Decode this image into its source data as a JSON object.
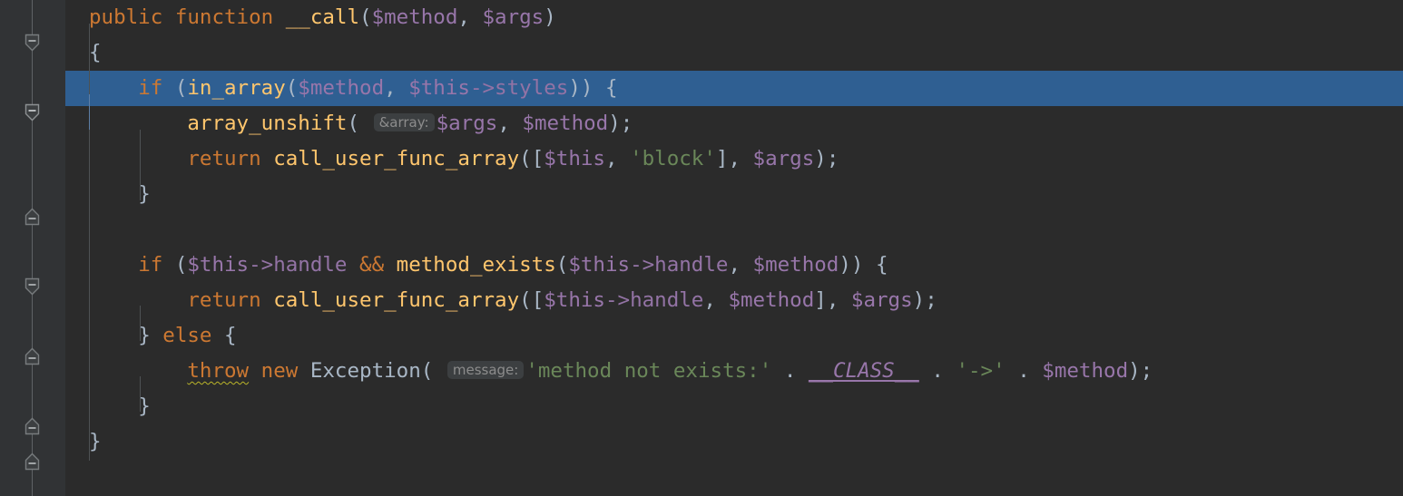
{
  "editor": {
    "language": "php",
    "theme": "darcula",
    "background_color": "#2b2b2b",
    "gutter_color": "#313335",
    "selection_color": "#2f5f92",
    "default_text_color": "#a9b7c6",
    "keyword_color": "#cc7832",
    "function_color": "#ffc66d",
    "variable_color": "#9876aa",
    "string_color": "#6a8759",
    "hint_background_color": "#3c3f41",
    "hint_text_color": "#8c8c8c",
    "error_squiggle_color": "#bbb529"
  },
  "gutter": {
    "fold_markers": [
      {
        "name": "fold-start-function-call",
        "direction": "down",
        "glyph": "minus"
      },
      {
        "name": "fold-start-if-in-array",
        "direction": "down",
        "glyph": "minus"
      },
      {
        "name": "fold-end-if-in-array",
        "direction": "up",
        "glyph": "minus"
      },
      {
        "name": "fold-start-if-handle",
        "direction": "down",
        "glyph": "minus"
      },
      {
        "name": "fold-end-if-handle",
        "direction": "up",
        "glyph": "minus"
      },
      {
        "name": "fold-end-else",
        "direction": "up",
        "glyph": "minus"
      },
      {
        "name": "fold-end-function-call",
        "direction": "up",
        "glyph": "minus"
      }
    ]
  },
  "code": {
    "lines": [
      {
        "index": 1,
        "selected": false,
        "text": "    public function __call($method, $args)"
      },
      {
        "index": 2,
        "selected": false,
        "text": "    {"
      },
      {
        "index": 3,
        "selected": true,
        "text": "        if (in_array($method, $this->styles)) {"
      },
      {
        "index": 4,
        "selected": false,
        "text": "            array_unshift( &array: $args, $method);",
        "hint": "&array:"
      },
      {
        "index": 5,
        "selected": false,
        "text": "            return call_user_func_array([$this, 'block'], $args);"
      },
      {
        "index": 6,
        "selected": false,
        "text": "        }"
      },
      {
        "index": 7,
        "selected": false,
        "text": ""
      },
      {
        "index": 8,
        "selected": false,
        "text": "        if ($this->handle && method_exists($this->handle, $method)) {"
      },
      {
        "index": 9,
        "selected": false,
        "text": "            return call_user_func_array([$this->handle, $method], $args);"
      },
      {
        "index": 10,
        "selected": false,
        "text": "        } else {"
      },
      {
        "index": 11,
        "selected": false,
        "text": "            throw new Exception( message: 'method not exists:' . __CLASS__ . '->' . $method);",
        "hint": "message:"
      },
      {
        "index": 12,
        "selected": false,
        "text": "        }"
      },
      {
        "index": 13,
        "selected": false,
        "text": "    }"
      }
    ],
    "tokens": {
      "kw_public": "public",
      "kw_function": "function",
      "fn_call": "__call",
      "var_method": "$method",
      "var_args": "$args",
      "var_this": "$this",
      "kw_if": "if",
      "fn_in_array": "in_array",
      "prop_styles": "styles",
      "fn_array_unshift": "array_unshift",
      "hint_array": "&array:",
      "kw_return": "return",
      "fn_call_user_func_array": "call_user_func_array",
      "str_block": "'block'",
      "prop_handle": "handle",
      "op_and": "&&",
      "fn_method_exists": "method_exists",
      "kw_else": "else",
      "kw_throw": "throw",
      "kw_new": "new",
      "cls_exception": "Exception",
      "hint_message": "message:",
      "str_message": "'method not exists:'",
      "const_class": "__CLASS__",
      "str_arrow": "'->'",
      "dot": ".",
      "semicolon": ";",
      "open_brace": "{",
      "close_brace": "}",
      "open_paren": "(",
      "close_paren": ")",
      "open_bracket": "[",
      "close_bracket": "]",
      "comma": ",",
      "arrow": "->"
    }
  }
}
